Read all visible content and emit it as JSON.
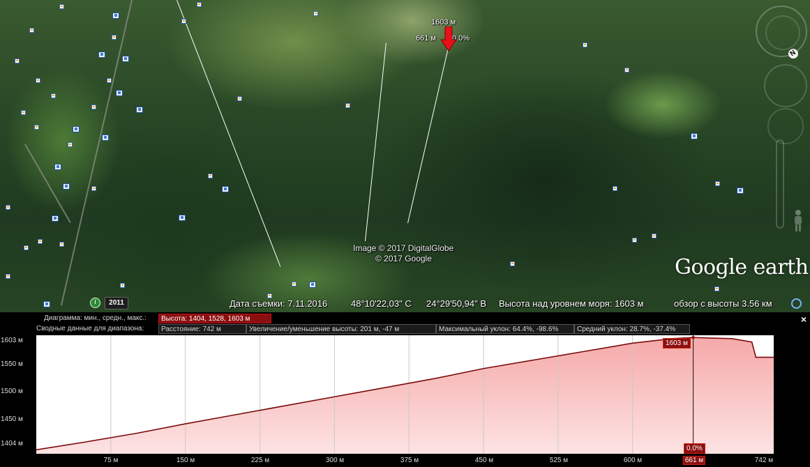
{
  "map": {
    "marker": {
      "elevation": "1603 м",
      "distance": "661 м",
      "slope": "0.0%"
    },
    "credits": {
      "image": "Image © 2017 DigitalGlobe",
      "google": "© 2017 Google"
    },
    "logo": "Google earth",
    "year": "2011",
    "status": {
      "date": "Дата съемки: 7.11.2016",
      "lat": "48°10'22,03\" С",
      "lon": "24°29'50,94\" В",
      "elevation": "Высота над уровнем моря:  1603 м",
      "eye_alt": "обзор с высоты   3.56 км"
    },
    "north_label": "N"
  },
  "profile": {
    "row1": {
      "label": "Диаграмма: мин., средн., макс.:",
      "value": "Высота: 1404, 1528, 1603 м"
    },
    "row2": {
      "label": "Сводные данные для диапазона:",
      "distance": "Расстояние: 742 м",
      "gain": "Увеличение/уменьшение высоты: 201 м, -47 м",
      "max_slope": "Максимальный уклон: 64.4%, -98.6%",
      "avg_slope": "Средний уклон: 28.7%, -37.4%"
    },
    "close": "×",
    "y_labels": [
      "1603 м",
      "1550 м",
      "1500 м",
      "1450 м",
      "1404 м"
    ],
    "x_labels": [
      "75 м",
      "150 м",
      "225 м",
      "300 м",
      "375 м",
      "450 м",
      "525 м",
      "600 м",
      "661 м",
      "742 м"
    ],
    "cursor_elevation": "1603 м",
    "cursor_slope": "0.0%",
    "colors": {
      "fill": "#f9c6c6",
      "line": "#7a0a0a",
      "highlight": "#8b0f0f"
    }
  },
  "chart_data": {
    "type": "area",
    "x": [
      0,
      50,
      100,
      150,
      200,
      250,
      300,
      350,
      400,
      450,
      500,
      550,
      600,
      640,
      661,
      700,
      720,
      724,
      742
    ],
    "values": [
      1404,
      1418,
      1433,
      1450,
      1466,
      1482,
      1498,
      1514,
      1530,
      1548,
      1563,
      1578,
      1593,
      1601,
      1603,
      1601,
      1595,
      1568,
      1568
    ],
    "xlim": [
      0,
      742
    ],
    "ylim": [
      1397,
      1607
    ],
    "xticks": [
      "75 м",
      "150 м",
      "225 м",
      "300 м",
      "375 м",
      "450 м",
      "525 м",
      "600 м",
      "661 м",
      "742 м"
    ],
    "yticks": [
      "1404 м",
      "1450 м",
      "1500 м",
      "1550 м",
      "1603 м"
    ],
    "cursor_x": 661,
    "grid": true
  }
}
